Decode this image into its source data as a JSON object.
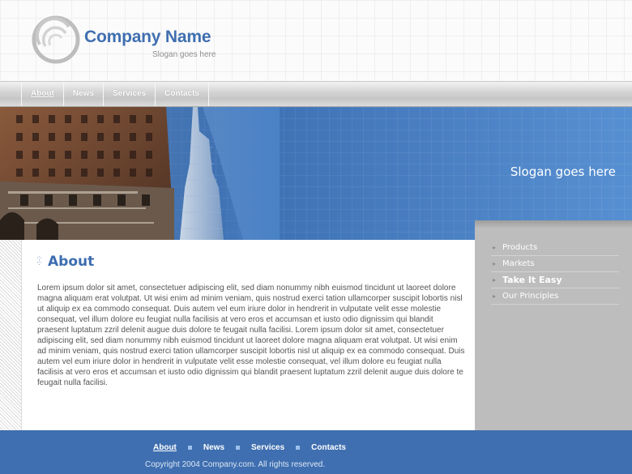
{
  "header": {
    "company_name": "Company Name",
    "slogan": "Slogan goes here",
    "logo_icon": "concentric-rings-logo-icon"
  },
  "nav": {
    "items": [
      {
        "label": "About",
        "active": true
      },
      {
        "label": "News",
        "active": false
      },
      {
        "label": "Services",
        "active": false
      },
      {
        "label": "Contacts",
        "active": false
      }
    ]
  },
  "banner": {
    "slogan": "Slogan goes here",
    "photo": "city-skyscrapers-photo"
  },
  "main": {
    "title": "About",
    "body": "Lorem ipsum dolor sit amet, consectetuer adipiscing elit, sed diam nonummy nibh euismod tincidunt ut laoreet dolore magna aliquam erat volutpat. Ut wisi enim ad minim veniam, quis nostrud exerci tation ullamcorper suscipit lobortis nisl ut aliquip ex ea commodo consequat. Duis autem vel eum iriure dolor in hendrerit in vulputate velit esse molestie consequat, vel illum dolore eu feugiat nulla facilisis at vero eros et accumsan et iusto odio dignissim qui blandit praesent luptatum zzril delenit augue duis dolore te feugait nulla facilisi. Lorem ipsum dolor sit amet, consectetuer adipiscing elit, sed diam nonummy nibh euismod tincidunt ut laoreet dolore magna aliquam erat volutpat. Ut wisi enim ad minim veniam, quis nostrud exerci tation ullamcorper suscipit lobortis nisl ut aliquip ex ea commodo consequat. Duis autem vel eum iriure dolor in hendrerit in vulputate velit esse molestie consequat, vel illum dolore eu feugiat nulla facilisis at vero eros et accumsan et iusto odio dignissim qui blandit praesent luptatum zzril delenit augue duis dolore te feugait nulla facilisi."
  },
  "sidebar": {
    "items": [
      {
        "label": "Products",
        "bold": false
      },
      {
        "label": "Markets",
        "bold": false
      },
      {
        "label": "Take It Easy",
        "bold": true
      },
      {
        "label": "Our Principles",
        "bold": false
      }
    ]
  },
  "footer": {
    "links": [
      {
        "label": "About",
        "active": true
      },
      {
        "label": "News",
        "active": false
      },
      {
        "label": "Services",
        "active": false
      },
      {
        "label": "Contacts",
        "active": false
      }
    ],
    "copyright": "Copyright 2004 Company.com. All rights reserved."
  },
  "colors": {
    "brand_blue": "#3f6fb0",
    "sidebar_gray": "#bdbdbd"
  }
}
